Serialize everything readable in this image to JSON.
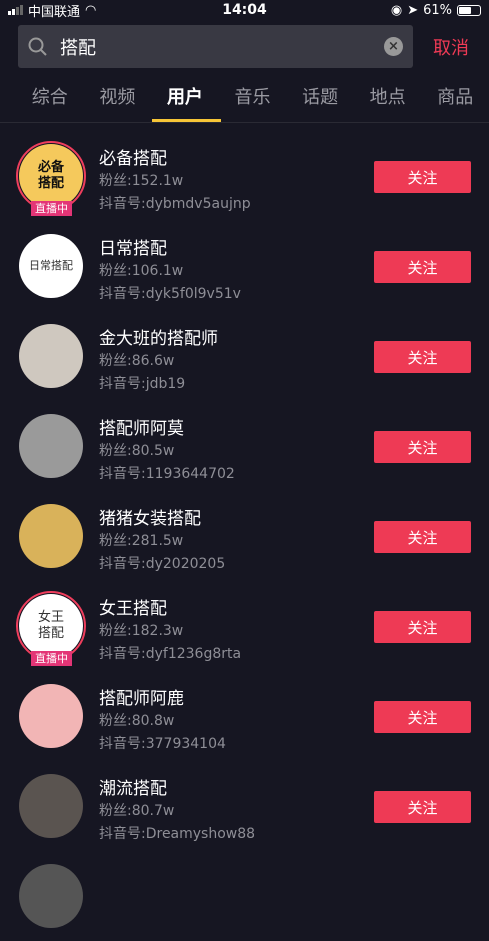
{
  "status": {
    "carrier": "中国联通",
    "time": "14:04",
    "battery": "61%"
  },
  "search": {
    "query": "搭配",
    "cancel": "取消"
  },
  "tabs": [
    "综合",
    "视频",
    "用户",
    "音乐",
    "话题",
    "地点",
    "商品"
  ],
  "live_label": "直播中",
  "follow_label": "关注",
  "users": [
    {
      "name": "必备搭配",
      "fans": "粉丝:152.1w",
      "uid": "抖音号:dybmdv5aujnp",
      "live": true,
      "avatar_text": "必备搭配",
      "avatar_bg": "#f5c95c"
    },
    {
      "name": "日常搭配",
      "fans": "粉丝:106.1w",
      "uid": "抖音号:dyk5f0l9v51v",
      "live": false,
      "avatar_text": "日常搭配",
      "avatar_bg": "#ffffff"
    },
    {
      "name": "金大班的搭配师",
      "fans": "粉丝:86.6w",
      "uid": "抖音号:jdb19",
      "live": false,
      "avatar_bg": "#cfc8bf"
    },
    {
      "name": "搭配师阿莫",
      "fans": "粉丝:80.5w",
      "uid": "抖音号:1193644702",
      "live": false,
      "avatar_bg": "#9a9a9a"
    },
    {
      "name": "猪猪女装搭配",
      "fans": "粉丝:281.5w",
      "uid": "抖音号:dy2020205",
      "live": false,
      "avatar_bg": "#d9b25a"
    },
    {
      "name": "女王搭配",
      "fans": "粉丝:182.3w",
      "uid": "抖音号:dyf1236g8rta",
      "live": true,
      "avatar_text": "女王搭配",
      "avatar_bg": "#ffffff"
    },
    {
      "name": "搭配师阿鹿",
      "fans": "粉丝:80.8w",
      "uid": "抖音号:377934104",
      "live": false,
      "avatar_bg": "#f2b5b5"
    },
    {
      "name": "潮流搭配",
      "fans": "粉丝:80.7w",
      "uid": "抖音号:Dreamyshow88",
      "live": false,
      "avatar_bg": "#5a5450"
    }
  ]
}
